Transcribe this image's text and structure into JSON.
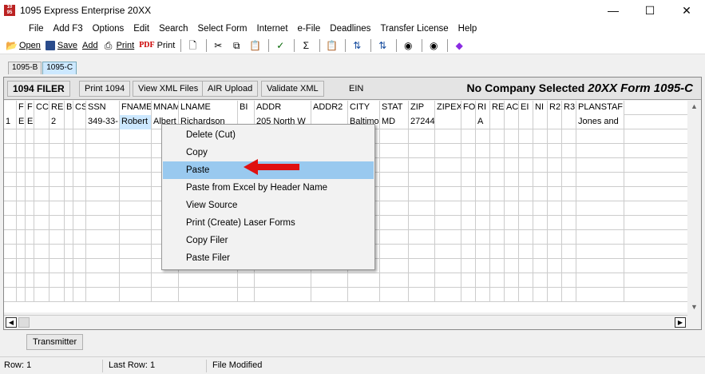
{
  "window": {
    "title": "1095 Express Enterprise 20XX",
    "icon": "app-logo-icon",
    "minimize": "—",
    "maximize": "☐",
    "close": "✕"
  },
  "menu": [
    "File",
    "Add F3",
    "Options",
    "Edit",
    "Search",
    "Select Form",
    "Internet",
    "e-File",
    "Deadlines",
    "Transfer License",
    "Help"
  ],
  "toolbar": {
    "open": "Open",
    "save": "Save",
    "add": "Add",
    "print": "Print",
    "pdf_print": "Print",
    "pdf_prefix": "PDF"
  },
  "tabs": [
    "1095-B",
    "1095-C"
  ],
  "panel": {
    "filer_label": "1094 FILER",
    "print_1094": "Print 1094",
    "view_xml": "View XML Files",
    "air_upload": "AIR Upload",
    "validate_xml": "Validate XML",
    "ein_label": "EIN",
    "company_text": "No Company Selected",
    "form_text": "20XX  Form 1095-C"
  },
  "grid": {
    "headers": [
      "",
      "F",
      "F",
      "CC",
      "RE",
      "B",
      "CS",
      "SSN",
      "FNAME",
      "MNAM",
      "LNAME",
      "BI",
      "ADDR",
      "ADDR2",
      "CITY",
      "STAT",
      "ZIP",
      "ZIPEX",
      "FOI",
      "RI",
      "RE",
      "AC",
      "EI",
      "NI",
      "R2",
      "R3",
      "PLANSTAF"
    ],
    "rows": [
      [
        "1",
        "E",
        "E",
        "",
        "2",
        "",
        "",
        "349-33-",
        "Robert",
        "Albert",
        "Richardson",
        "",
        "205 North W",
        "",
        "Baltimo",
        "MD",
        "27244",
        "",
        "",
        "A",
        "",
        "",
        "",
        "",
        "",
        "",
        "Jones and"
      ]
    ]
  },
  "context_menu": [
    {
      "label": "Delete (Cut)",
      "highlighted": false
    },
    {
      "label": "Copy",
      "highlighted": false
    },
    {
      "label": "Paste",
      "highlighted": true
    },
    {
      "label": "Paste from Excel by Header Name",
      "highlighted": false
    },
    {
      "label": "View Source",
      "highlighted": false
    },
    {
      "label": "Print (Create) Laser Forms",
      "highlighted": false
    },
    {
      "label": "Copy Filer",
      "highlighted": false
    },
    {
      "label": "Paste Filer",
      "highlighted": false
    }
  ],
  "transmitter_label": "Transmitter",
  "status": {
    "row": "Row: 1",
    "last_row": "Last Row: 1",
    "modified": "File Modified"
  },
  "colors": {
    "highlight": "#99c9ef",
    "arrow": "#e01010",
    "active_tab": "#cce8ff"
  }
}
